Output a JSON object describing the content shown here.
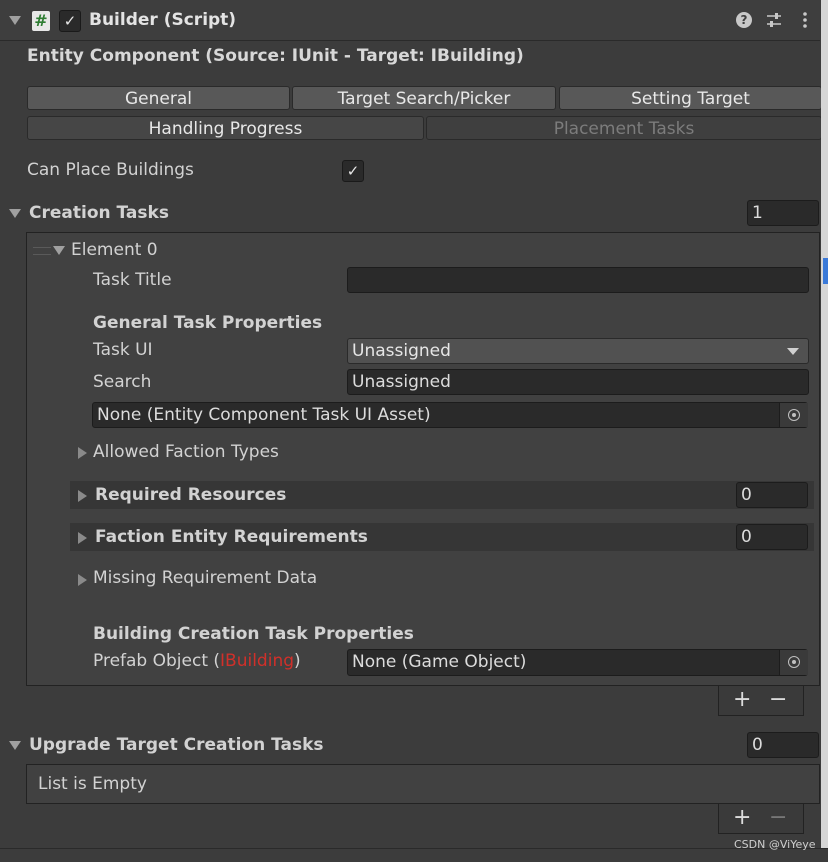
{
  "header": {
    "title": "Builder (Script)",
    "hash_glyph": "#",
    "check_glyph": "✓"
  },
  "subtitle": "Entity Component (Source: IUnit - Target: IBuilding)",
  "tabs_row1": [
    "General",
    "Target Search/Picker",
    "Setting Target"
  ],
  "tabs_row2": [
    "Handling Progress",
    "Placement Tasks"
  ],
  "can_place": {
    "label": "Can Place Buildings",
    "checked": true,
    "glyph": "✓"
  },
  "creation_tasks": {
    "label": "Creation Tasks",
    "count": "1",
    "element": {
      "label": "Element 0",
      "task_title_label": "Task Title",
      "task_title_value": "",
      "general_header": "General Task Properties",
      "task_ui_label": "Task UI",
      "task_ui_value": "Unassigned",
      "search_label": "Search",
      "search_value": "Unassigned",
      "asset_value": "None (Entity Component Task UI Asset)",
      "allowed_faction": "Allowed Faction Types",
      "required_resources": {
        "label": "Required Resources",
        "count": "0"
      },
      "faction_requirements": {
        "label": "Faction Entity Requirements",
        "count": "0"
      },
      "missing_data": "Missing Requirement Data",
      "building_header": "Building Creation Task Properties",
      "prefab_prefix": "Prefab Object (",
      "prefab_type": "IBuilding",
      "prefab_suffix": ")",
      "prefab_value": "None (Game Object)"
    },
    "plus": "+",
    "minus": "−"
  },
  "upgrade_tasks": {
    "label": "Upgrade Target Creation Tasks",
    "count": "0",
    "empty_text": "List is Empty",
    "plus": "+",
    "minus": "−"
  },
  "watermark": "CSDN @ViYeye",
  "colors": {
    "accent_blue": "#3a79d8",
    "type_red": "#d0302a"
  }
}
